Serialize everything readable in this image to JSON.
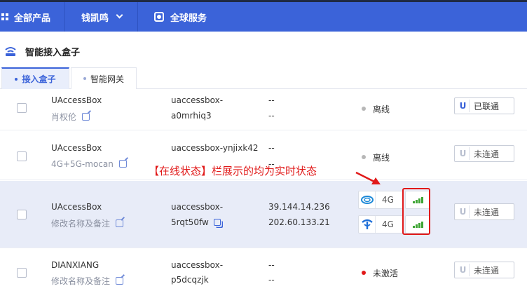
{
  "topbar": {
    "all_products": "全部产品",
    "user": "钱凯鸣",
    "global_service": "全球服务"
  },
  "page": {
    "title": "智能接入盒子"
  },
  "tabs": [
    {
      "label": "接入盒子",
      "active": true
    },
    {
      "label": "智能网关",
      "active": false
    }
  ],
  "annotation": "【在线状态】栏展示的均为实时状态",
  "rows": [
    {
      "name": "UAccessBox",
      "note": "肖权伦",
      "id_line1": "uaccessbox-",
      "id_line2": "a0mrhiq3",
      "ip1": "--",
      "ip2": "--",
      "status": "离线",
      "status_color": "#b7b7b7",
      "button": "已联通",
      "button_u": "U"
    },
    {
      "name": "UAccessBox",
      "note": "4G+5G-mocan",
      "id_line1": "uaccessbox-ynjixk42",
      "id_line2": "",
      "ip1": "--",
      "ip2": "--",
      "status": "离线",
      "status_color": "#b7b7b7",
      "button": "未连通",
      "button_u": "U"
    },
    {
      "name": "UAccessBox",
      "note": "修改名称及备注",
      "id_line1": "uaccessbox-",
      "id_line2": "5rqt50fw",
      "ip1": "39.144.14.236",
      "ip2": "202.60.133.21",
      "carrier1": "4G",
      "carrier2": "4G",
      "button": "未连通",
      "button_u": "U"
    },
    {
      "name": "DIANXIANG",
      "note": "修改名称及备注",
      "id_line1": "uaccessbox-",
      "id_line2": "p5dcqzjk",
      "ip1": "--",
      "ip2": "--",
      "status": "未激活",
      "status_color": "#e11919",
      "button": "未连通",
      "button_u": "U"
    }
  ],
  "colors": {
    "brand": "#3b63d9",
    "highlight_row": "#e8ecf8",
    "annotation_red": "#e11919",
    "signal_green": "#3fa535"
  },
  "icons": {
    "products": "grid-icon",
    "user_menu": "chevron-down-icon",
    "global": "globe-icon",
    "title": "wifi-icon",
    "edit": "edit-icon",
    "copy": "copy-icon",
    "carrier_mobile": "china-mobile-logo-icon",
    "carrier_telecom": "china-telecom-logo-icon",
    "signal": "signal-bars-icon"
  }
}
